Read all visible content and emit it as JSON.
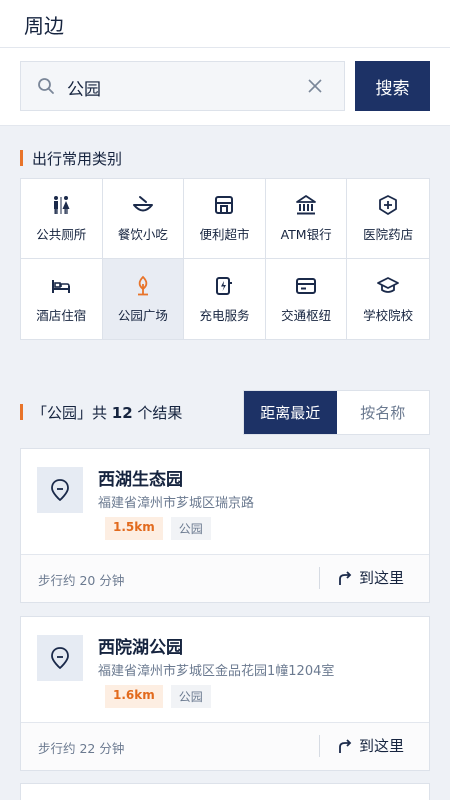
{
  "header": {
    "title": "周边"
  },
  "search": {
    "value": "公园",
    "clear_icon": "close-icon",
    "button_label": "搜索"
  },
  "categories": {
    "title": "出行常用类别",
    "items": [
      {
        "label": "公共厕所",
        "icon": "restroom-icon"
      },
      {
        "label": "餐饮小吃",
        "icon": "bowl-icon"
      },
      {
        "label": "便利超市",
        "icon": "store-icon"
      },
      {
        "label": "ATM银行",
        "icon": "bank-icon"
      },
      {
        "label": "医院药店",
        "icon": "medical-icon"
      },
      {
        "label": "酒店住宿",
        "icon": "bed-icon"
      },
      {
        "label": "公园广场",
        "icon": "park-icon",
        "active": true
      },
      {
        "label": "充电服务",
        "icon": "charging-icon"
      },
      {
        "label": "交通枢纽",
        "icon": "transit-card-icon"
      },
      {
        "label": "学校院校",
        "icon": "graduation-cap-icon"
      }
    ]
  },
  "results": {
    "prefix": "「公园」共 ",
    "count": "12",
    "suffix": " 个结果",
    "sort": {
      "nearest": "距离最近",
      "by_name": "按名称"
    },
    "items": [
      {
        "name": "西湖生态园",
        "address": "福建省漳州市芗城区瑞京路",
        "distance": "1.5km",
        "category": "公园",
        "walk": "步行约 20 分钟",
        "action": "到这里"
      },
      {
        "name": "西院湖公园",
        "address": "福建省漳州市芗城区金品花园1幢1204室",
        "distance": "1.6km",
        "category": "公园",
        "walk": "步行约 22 分钟",
        "action": "到这里"
      }
    ]
  },
  "colors": {
    "primary": "#1d3266",
    "accent": "#e8742a",
    "background": "#eef1f6"
  }
}
